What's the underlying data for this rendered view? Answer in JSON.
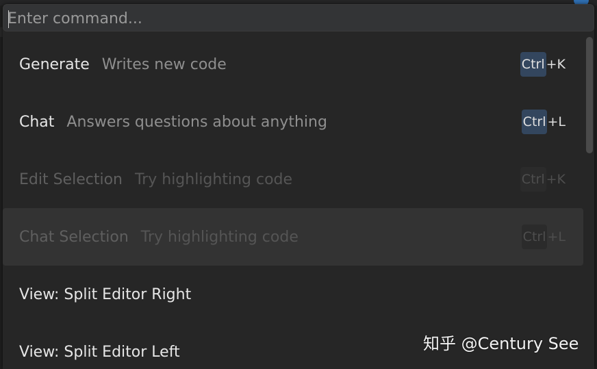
{
  "command_palette": {
    "input": {
      "placeholder": "Enter command...",
      "value": ""
    },
    "items": [
      {
        "title": "Generate",
        "description": "Writes new code",
        "shortcut_mod": "Ctrl",
        "shortcut_sep": "+",
        "shortcut_key": "K",
        "enabled": true
      },
      {
        "title": "Chat",
        "description": "Answers questions about anything",
        "shortcut_mod": "Ctrl",
        "shortcut_sep": "+",
        "shortcut_key": "L",
        "enabled": true
      },
      {
        "title": "Edit Selection",
        "description": "Try highlighting code",
        "shortcut_mod": "Ctrl",
        "shortcut_sep": "+",
        "shortcut_key": "K",
        "enabled": false
      },
      {
        "title": "Chat Selection",
        "description": "Try highlighting code",
        "shortcut_mod": "Ctrl",
        "shortcut_sep": "+",
        "shortcut_key": "L",
        "enabled": false,
        "hovered": true
      },
      {
        "title": "View: Split Editor Right",
        "enabled": true
      },
      {
        "title": "View: Split Editor Left",
        "enabled": true
      }
    ]
  },
  "watermark": {
    "text": "知乎 @Century See"
  },
  "colors": {
    "palette_bg": "#262626",
    "input_bg": "#333436",
    "shortcut_key_bg": "#33465e",
    "hover_row_bg": "#333333"
  }
}
